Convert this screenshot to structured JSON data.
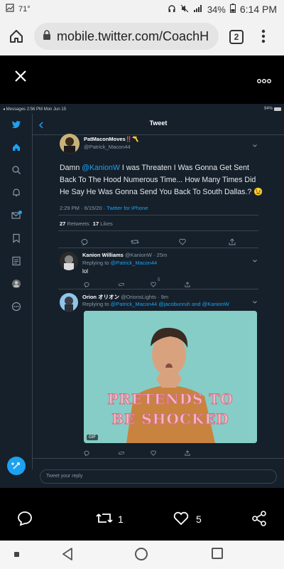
{
  "status_bar": {
    "temperature": "71°",
    "battery": "34%",
    "time": "6:14 PM"
  },
  "browser": {
    "url": "mobile.twitter.com/CoachH",
    "tab_count": "2"
  },
  "inner_status": {
    "left": "◂ Messages  2:56 PM   Mon Jun 15",
    "right": "94%"
  },
  "tweet_page": {
    "title": "Tweet",
    "author_name": "PatMaconMoves‼️〽️",
    "author_handle": "@Patrick_Macon44",
    "text_before_mention": "Damn ",
    "mention": "@KanionW",
    "text_after_mention": " I was Threaten I Was Gonna Get Sent Back To The Hood Numerous Time... How Many Times Did He Say He Was Gonna Send You Back To South Dallas.? 😉",
    "timestamp": "2:29 PM · 6/15/20 · ",
    "source": "Twitter for iPhone",
    "retweets_count": "27",
    "retweets_label": "Retweets",
    "likes_count": "17",
    "likes_label": "Likes"
  },
  "replies": [
    {
      "name": "Kanion Williams",
      "handle_time": "@KanionW · 25m",
      "replying_prefix": "Replying to ",
      "replying_to": "@Patrick_Macon44",
      "text": "lol",
      "like_count": "5"
    },
    {
      "name": "Orion オリオン",
      "handle_time": "@OrionsLights · 9m",
      "replying_prefix": "Replying to ",
      "replying_to": "@Patrick_Macon44 @jacobunruh and @KanionW",
      "gif_caption_line1": "PRETENDS TO",
      "gif_caption_line2": "BE SHOCKED",
      "gif_badge": "GIF"
    }
  ],
  "reply_placeholder": "Tweet your reply",
  "bottom_bar": {
    "retweet_count": "1",
    "like_count": "5"
  },
  "colors": {
    "twitter_bg": "#15202b",
    "twitter_blue": "#1da1f2",
    "border": "#38444d"
  }
}
